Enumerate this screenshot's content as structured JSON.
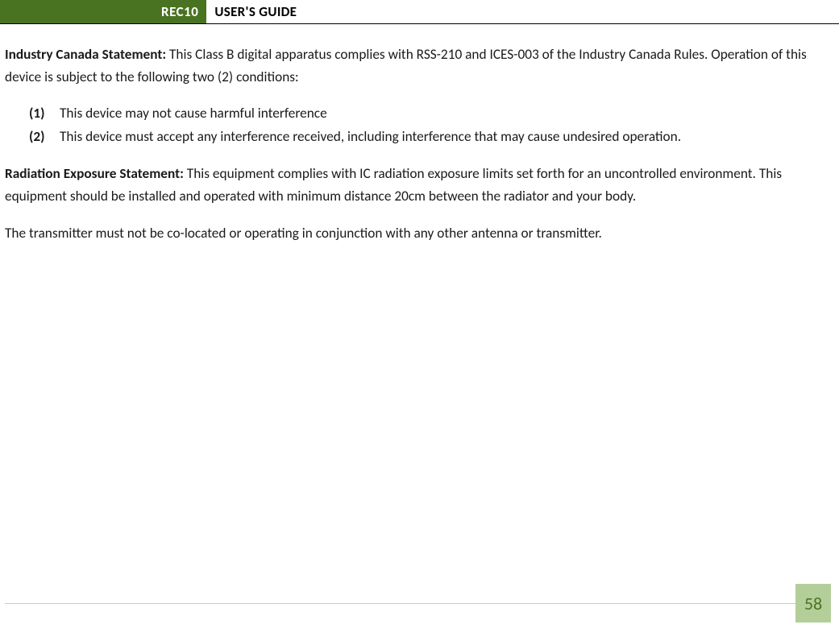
{
  "header": {
    "badge": "REC10",
    "title": "USER'S GUIDE"
  },
  "section1": {
    "label": "Industry Canada Statement:",
    "text": " This Class B digital apparatus complies with RSS-210 and ICES-003 of the Industry Canada Rules.  Operation of this device is subject to the following two (2) conditions:"
  },
  "list": {
    "items": [
      {
        "marker": "(1)",
        "text": "This device may not cause harmful interference"
      },
      {
        "marker": "(2)",
        "text": "This device must accept any interference received, including interference that may cause undesired operation."
      }
    ]
  },
  "section2": {
    "label": "Radiation Exposure Statement:",
    "text": " This equipment complies with IC radiation exposure limits set forth for an uncontrolled environment.  This equipment should be installed and operated with minimum distance 20cm between the radiator and your body."
  },
  "section3": {
    "text": "The transmitter must not be co-located or operating in conjunction with any other antenna or transmitter."
  },
  "page_number": "58"
}
